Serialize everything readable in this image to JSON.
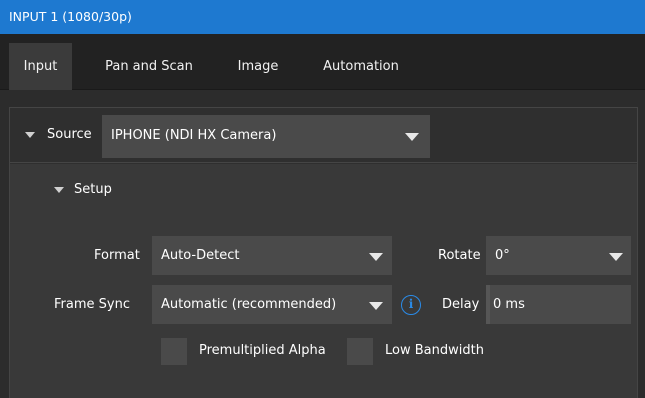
{
  "window": {
    "title": "INPUT 1  (1080/30p)"
  },
  "tabs": [
    {
      "label": "Input",
      "active": true
    },
    {
      "label": "Pan and Scan",
      "active": false
    },
    {
      "label": "Image",
      "active": false
    },
    {
      "label": "Automation",
      "active": false
    }
  ],
  "source": {
    "label": "Source",
    "value": "IPHONE (NDI HX Camera)"
  },
  "setup": {
    "label": "Setup",
    "format": {
      "label": "Format",
      "value": "Auto-Detect"
    },
    "rotate": {
      "label": "Rotate",
      "value": "0°"
    },
    "frame_sync": {
      "label": "Frame Sync",
      "value": "Automatic (recommended)"
    },
    "info_icon_glyph": "i",
    "delay": {
      "label": "Delay",
      "value": "0 ms"
    },
    "premultiplied_alpha": {
      "label": "Premultiplied Alpha",
      "checked": false
    },
    "low_bandwidth": {
      "label": "Low Bandwidth",
      "checked": false
    }
  },
  "colors": {
    "titlebar": "#1e79d0",
    "accent": "#2a8be8",
    "background": "#2c2c2c",
    "control": "#4a4a4a"
  },
  "icons": [
    "collapse-triangle-icon",
    "dropdown-caret-icon",
    "info-icon"
  ]
}
